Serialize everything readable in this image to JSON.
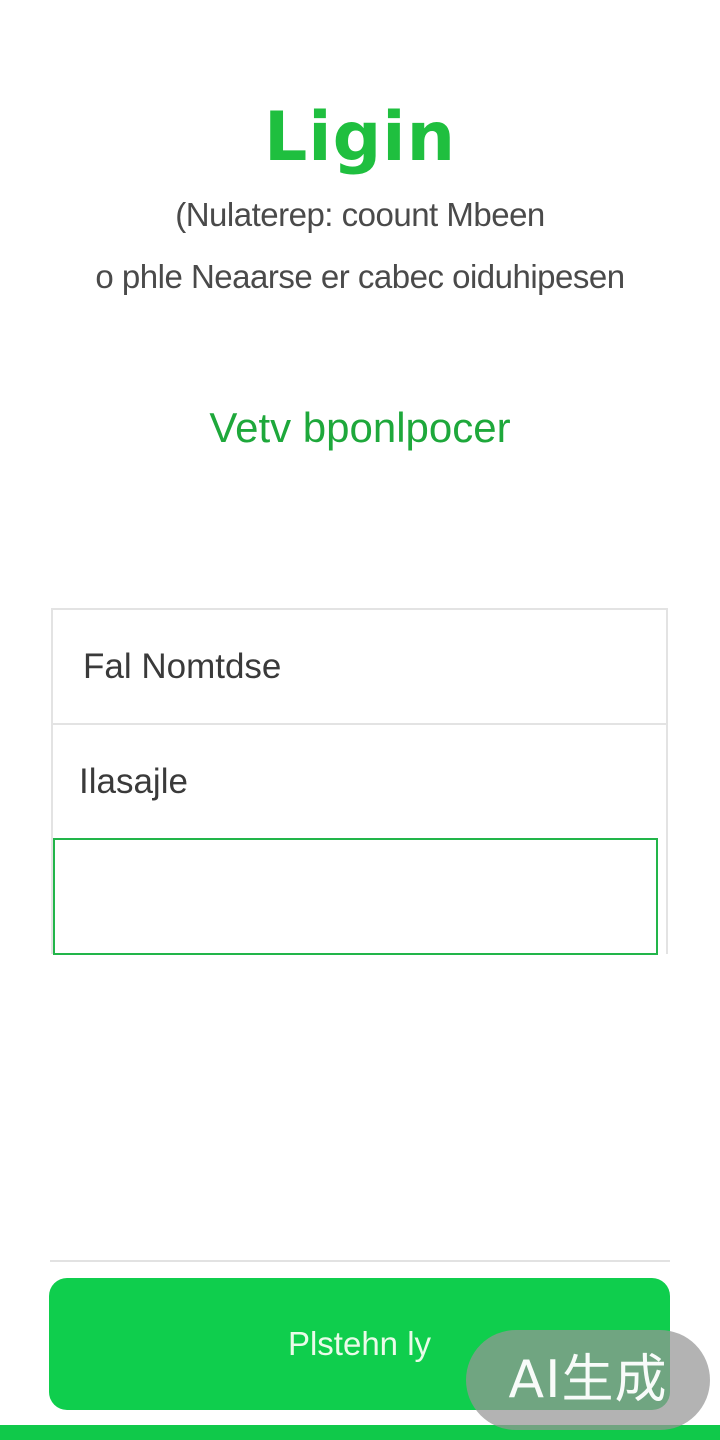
{
  "header": {
    "title": "Ligin",
    "subtitle_line1": "(Nulaterep: coount Mbeen",
    "subtitle_line2": "o phle Neaarse er cabec oiduhipesen"
  },
  "link": {
    "label": "Vetv bponlpocer"
  },
  "form": {
    "name_field": {
      "placeholder": "Fal Nomtdse",
      "value": ""
    },
    "password_field": {
      "placeholder": "Ilasajle",
      "value": ""
    },
    "active_field": {
      "value": ""
    }
  },
  "submit": {
    "label": "Plstehn ly"
  },
  "watermark": {
    "text": "AI生成"
  },
  "colors": {
    "accent": "#1fbf3f",
    "button": "#0fce4d",
    "active_border": "#22b54a"
  }
}
